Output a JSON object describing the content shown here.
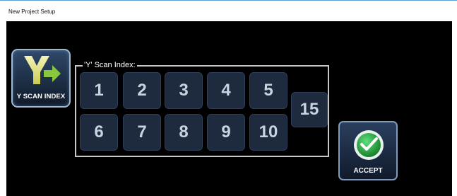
{
  "window": {
    "title": "New Project Setup"
  },
  "y_scan_button": {
    "label": "Y SCAN INDEX",
    "icon": "y-arrow-icon"
  },
  "group": {
    "legend": "'Y' Scan Index:"
  },
  "index_buttons": [
    "1",
    "2",
    "3",
    "4",
    "5",
    "6",
    "7",
    "8",
    "9",
    "10"
  ],
  "selected_value": "15",
  "accept_button": {
    "label": "ACCEPT",
    "icon": "check-circle-icon"
  },
  "colors": {
    "background": "#000000",
    "button_fill": "#1e2a3d",
    "button_text": "#c9d3df",
    "y_letter": "#e4e68a",
    "arrow": "#88c73e",
    "check_green": "#1fae3a"
  }
}
